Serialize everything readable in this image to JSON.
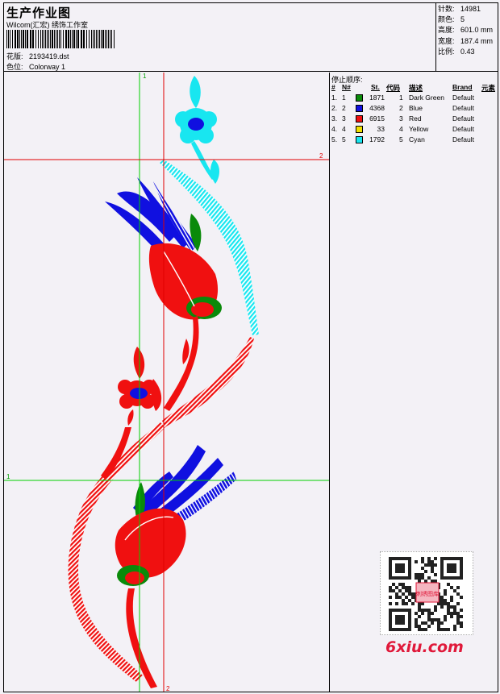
{
  "header": {
    "title": "生产作业图",
    "company": "Wilcom(汇宏) 绣饰工作室",
    "design_label": "花版:",
    "design_value": "2193419.dst",
    "colorway_label": "色位:",
    "colorway_value": "Colorway 1"
  },
  "stats": {
    "stitches_label": "针数:",
    "stitches_value": "14981",
    "colors_label": "颜色:",
    "colors_value": "5",
    "height_label": "高度:",
    "height_value": "601.0 mm",
    "width_label": "宽度:",
    "width_value": "187.4 mm",
    "scale_label": "比例:",
    "scale_value": "0.43"
  },
  "stop_sequence": {
    "title": "停止顺序:",
    "columns": [
      "#",
      "N#",
      "St.",
      "代码",
      "描述",
      "Brand",
      "元素"
    ],
    "rows": [
      {
        "n": "1.",
        "num": "1",
        "color": "#0a8a0a",
        "stitches": "1871",
        "code": "1",
        "desc": "Dark Green",
        "brand": "Default"
      },
      {
        "n": "2.",
        "num": "2",
        "color": "#1010e0",
        "stitches": "4368",
        "code": "2",
        "desc": "Blue",
        "brand": "Default"
      },
      {
        "n": "3.",
        "num": "3",
        "color": "#f01010",
        "stitches": "6915",
        "code": "3",
        "desc": "Red",
        "brand": "Default"
      },
      {
        "n": "4.",
        "num": "4",
        "color": "#f0e000",
        "stitches": "33",
        "code": "4",
        "desc": "Yellow",
        "brand": "Default"
      },
      {
        "n": "5.",
        "num": "5",
        "color": "#18e6f0",
        "stitches": "1792",
        "code": "5",
        "desc": "Cyan",
        "brand": "Default"
      }
    ]
  },
  "guides": {
    "v_label_1": "1",
    "h_label_2": "2",
    "h_label_1": "1",
    "v_label_2": "2"
  },
  "watermark": {
    "qr_center": "刺绣图库",
    "site": "6xiu.com"
  },
  "colors": {
    "guide_green": "#00d000",
    "guide_red": "#e00000"
  }
}
